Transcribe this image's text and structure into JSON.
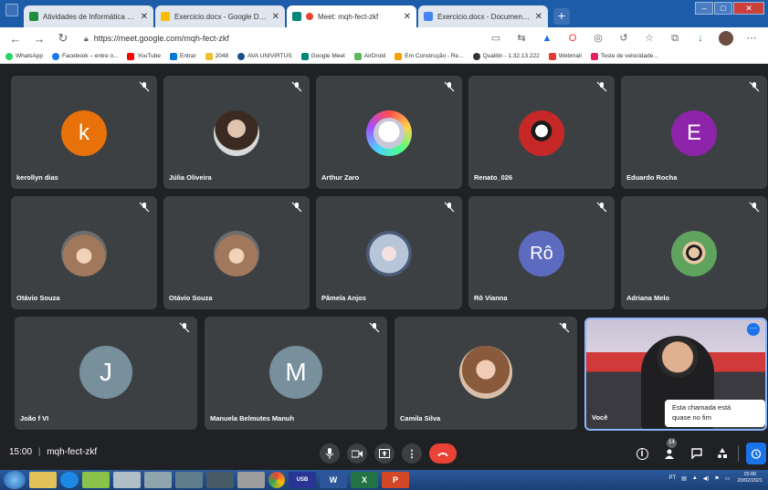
{
  "browser": {
    "tabs": [
      {
        "label": "Atividades de Informática Básica",
        "icon": "classroom-icon",
        "color": "#1e8e3e",
        "active": false
      },
      {
        "label": "Exercicio.docx - Google Drive",
        "icon": "drive-icon",
        "color": "#fbbc04",
        "active": false
      },
      {
        "label": "Meet: mqh-fect-zkf",
        "icon": "meet-icon",
        "color": "#ea4335",
        "active": true
      },
      {
        "label": "Exercicio.docx - Documentos Go",
        "icon": "docs-icon",
        "color": "#4285f4",
        "active": false
      }
    ],
    "new_tab": "+",
    "url": "https://meet.google.com/mqh-fect-zkf",
    "bookmarks": [
      {
        "label": "WhatsApp",
        "color": "#25d366"
      },
      {
        "label": "Facebook – entre o...",
        "color": "#1877f2"
      },
      {
        "label": "YouTube",
        "color": "#ff0000"
      },
      {
        "label": "Entrar",
        "color": "#0078d4"
      },
      {
        "label": "2048",
        "color": "#edc22e"
      },
      {
        "label": "AVA UNIVIRTUS",
        "color": "#1a4f8b"
      },
      {
        "label": "Google Meet",
        "color": "#00897b"
      },
      {
        "label": "AirDroid",
        "color": "#5cb85c"
      },
      {
        "label": "Em Construção - Re...",
        "color": "#f4a300"
      },
      {
        "label": "Qualitin - 1.32.13.222",
        "color": "#333333"
      },
      {
        "label": "Webmail",
        "color": "#e53935"
      },
      {
        "label": "Teste de velocidade...",
        "color": "#e91e63"
      }
    ]
  },
  "participants": [
    {
      "name": "kerollyn dias",
      "initial": "k",
      "avatar_color": "#e8710a",
      "type": "letter"
    },
    {
      "name": "Júlia Oliveira",
      "type": "photo",
      "avatar_color": "#6b4c3b"
    },
    {
      "name": "Arthur Zaro",
      "type": "photo",
      "avatar_color": "#b0b0c8"
    },
    {
      "name": "Renato_026",
      "type": "photo",
      "avatar_color": "#c62828"
    },
    {
      "name": "Eduardo Rocha",
      "initial": "E",
      "avatar_color": "#8e24aa",
      "type": "letter"
    },
    {
      "name": "Otávio Souza",
      "type": "photo",
      "avatar_color": "#a1785c"
    },
    {
      "name": "Otávio Souza",
      "type": "photo",
      "avatar_color": "#a1785c"
    },
    {
      "name": "Pâmela Anjos",
      "type": "photo",
      "avatar_color": "#9aa5b8"
    },
    {
      "name": "Rô Vianna",
      "initial": "Rô",
      "avatar_color": "#5c6bc0",
      "type": "letter"
    },
    {
      "name": "Adriana Melo",
      "type": "photo",
      "avatar_color": "#4caf50"
    },
    {
      "name": "João f VI",
      "initial": "J",
      "avatar_color": "#78909c",
      "type": "letter"
    },
    {
      "name": "Manuela Belmutes Manuh",
      "initial": "M",
      "avatar_color": "#78909c",
      "type": "letter"
    },
    {
      "name": "Camila Silva",
      "type": "photo",
      "avatar_color": "#c09070"
    }
  ],
  "self_tile": {
    "name": "Você"
  },
  "tooltip": {
    "line1": "Esta chamada está",
    "line2": "quase no fim"
  },
  "controls": {
    "time": "15:00",
    "separator": "|",
    "meeting_code": "mqh-fect-zkf",
    "participant_count": "14"
  },
  "taskbar": {
    "language": "PT",
    "time": "15:00",
    "date": "20/02/2021"
  }
}
